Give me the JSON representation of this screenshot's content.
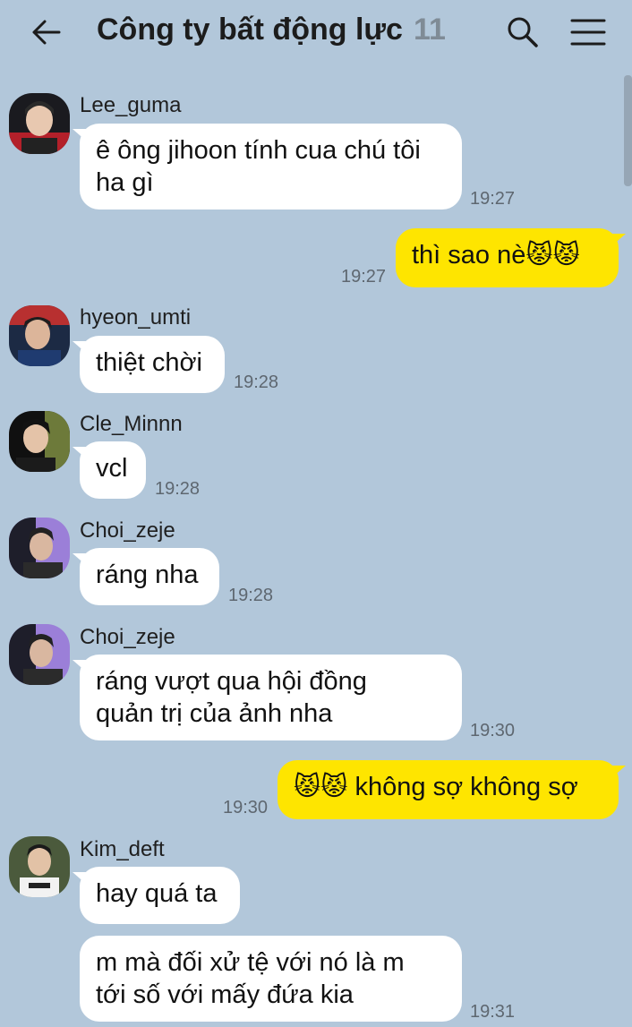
{
  "header": {
    "title": "Công ty bất động lực",
    "member_count": "11",
    "back_icon": "back-arrow-icon",
    "search_icon": "search-icon",
    "menu_icon": "hamburger-menu-icon"
  },
  "colors": {
    "background": "#b2c7da",
    "my_bubble": "#fee500",
    "other_bubble": "#ffffff"
  },
  "messages": [
    {
      "sender": "Lee_guma",
      "lines": [
        "ê ông jihoon tính cua chú tôi",
        "ha gì"
      ],
      "time": "19:27"
    },
    {
      "mine": true,
      "text": "thì sao nè😾😾",
      "time": "19:27"
    },
    {
      "sender": "hyeon_umti",
      "text": "thiệt chời",
      "time": "19:28"
    },
    {
      "sender": "Cle_Minnn",
      "text": "vcl",
      "time": "19:28"
    },
    {
      "sender": "Choi_zeje",
      "text": "ráng nha",
      "time": "19:28"
    },
    {
      "sender": "Choi_zeje",
      "lines": [
        "ráng vượt qua hội đồng",
        "quản trị của ảnh nha"
      ],
      "time": "19:30"
    },
    {
      "mine": true,
      "text": "😾😾 không sợ không sợ",
      "time": "19:30"
    },
    {
      "sender": "Kim_deft",
      "text": "hay quá ta",
      "time": ""
    },
    {
      "sender": "Kim_deft",
      "lines": [
        "m mà đối xử tệ với nó là m",
        "tới số với mấy đứa kia"
      ],
      "time": "19:31"
    }
  ]
}
